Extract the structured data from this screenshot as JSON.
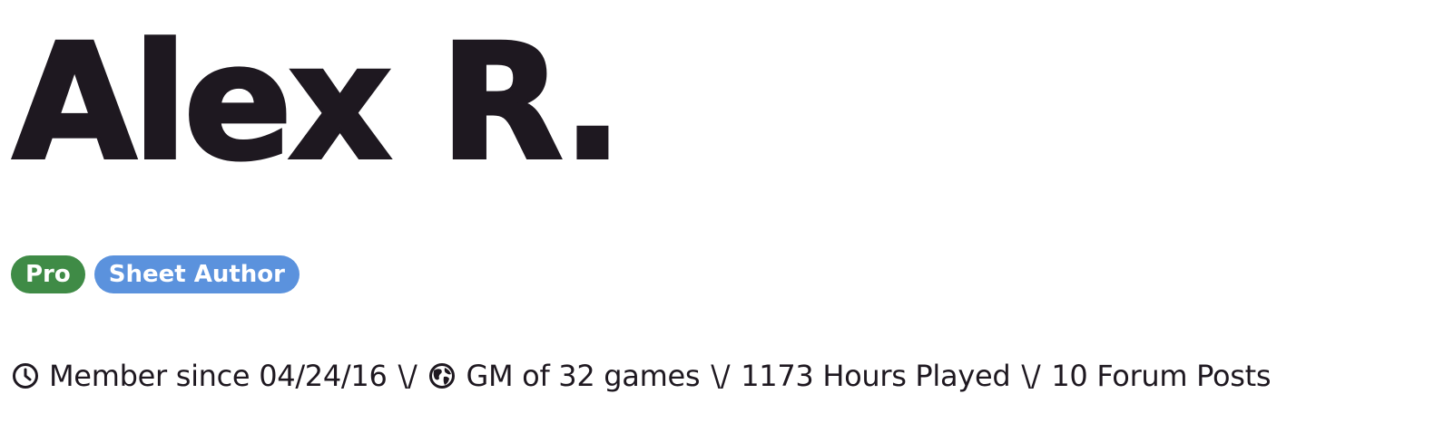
{
  "profile": {
    "name": "Alex R.",
    "badges": [
      {
        "label": "Pro",
        "color": "#3f8b46"
      },
      {
        "label": "Sheet Author",
        "color": "#5b92dd"
      }
    ],
    "stats": {
      "member_since": "Member since 04/24/16",
      "gm_games": "GM of 32 games",
      "hours_played": "1173 Hours Played",
      "forum_posts": "10 Forum Posts",
      "separator": "\\/"
    },
    "icons": {
      "member_since": "clock-icon",
      "gm_games": "globe-icon"
    }
  },
  "colors": {
    "text": "#1e1820",
    "background": "#ffffff"
  }
}
